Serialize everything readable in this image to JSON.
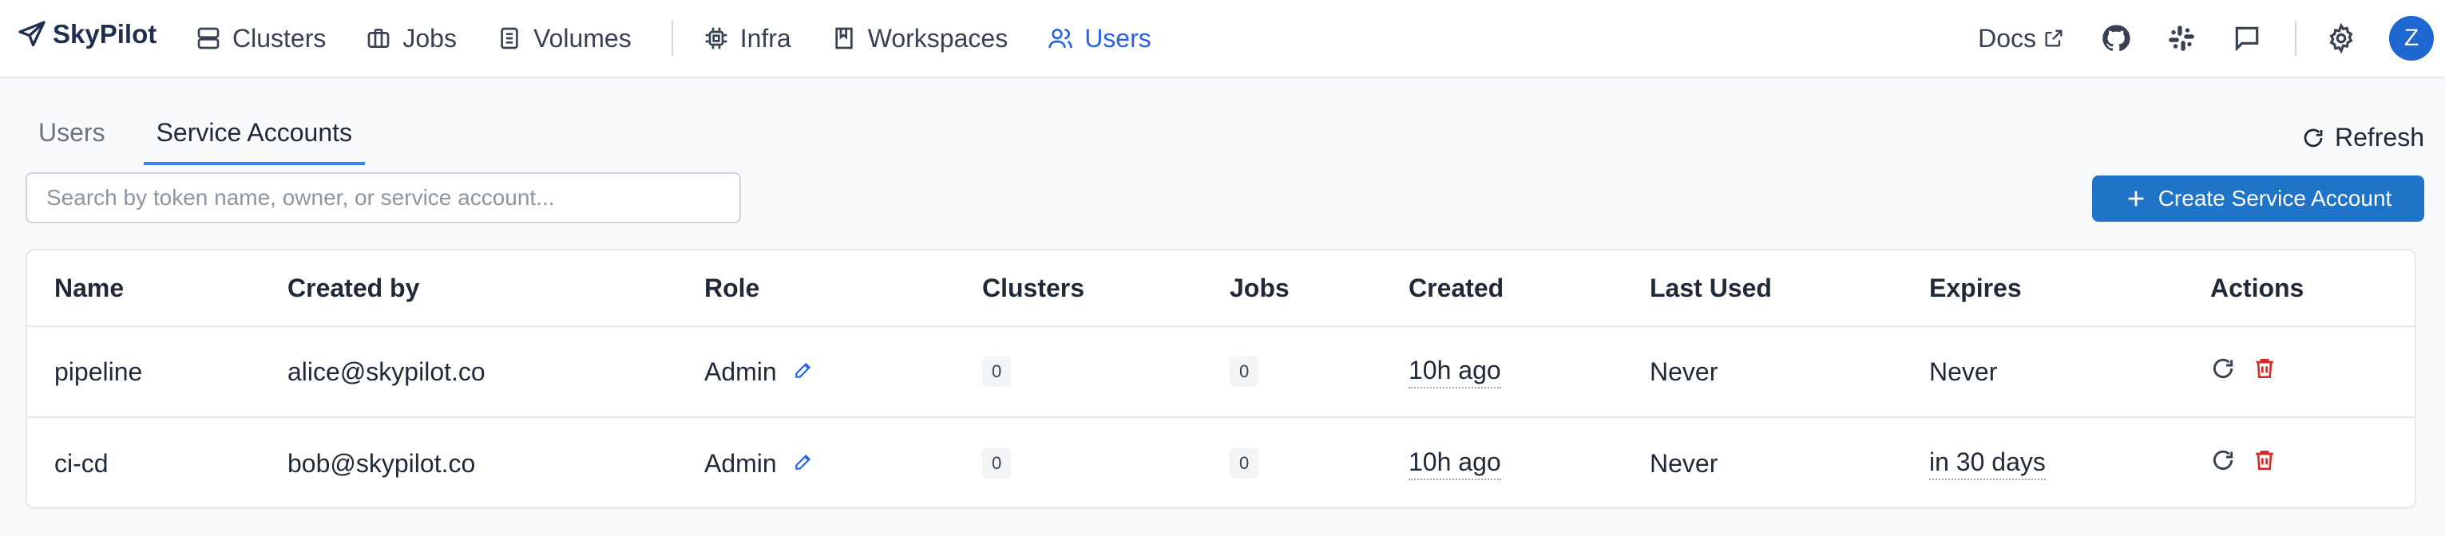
{
  "brand": {
    "name": "SkyPilot"
  },
  "nav": {
    "items": [
      {
        "label": "Clusters",
        "icon": "server-icon"
      },
      {
        "label": "Jobs",
        "icon": "briefcase-icon"
      },
      {
        "label": "Volumes",
        "icon": "volume-icon"
      },
      {
        "label": "Infra",
        "icon": "cpu-icon"
      },
      {
        "label": "Workspaces",
        "icon": "book-icon"
      },
      {
        "label": "Users",
        "icon": "users-icon",
        "active": true
      }
    ]
  },
  "right_nav": {
    "docs": "Docs",
    "avatar": "Z"
  },
  "tabs": [
    {
      "label": "Users",
      "active": false
    },
    {
      "label": "Service Accounts",
      "active": true
    }
  ],
  "toolbar": {
    "refresh": "Refresh",
    "search_placeholder": "Search by token name, owner, or service account...",
    "create": "Create Service Account"
  },
  "table": {
    "headers": [
      "Name",
      "Created by",
      "Role",
      "Clusters",
      "Jobs",
      "Created",
      "Last Used",
      "Expires",
      "Actions"
    ],
    "rows": [
      {
        "name": "pipeline",
        "created_by": "alice@skypilot.co",
        "role": "Admin",
        "clusters": "0",
        "jobs": "0",
        "created": "10h ago",
        "last_used": "Never",
        "expires": "Never"
      },
      {
        "name": "ci-cd",
        "created_by": "bob@skypilot.co",
        "role": "Admin",
        "clusters": "0",
        "jobs": "0",
        "created": "10h ago",
        "last_used": "Never",
        "expires": "in 30 days"
      }
    ]
  },
  "colors": {
    "accent": "#2563eb",
    "button": "#1f74c8",
    "danger": "#dc2626"
  }
}
